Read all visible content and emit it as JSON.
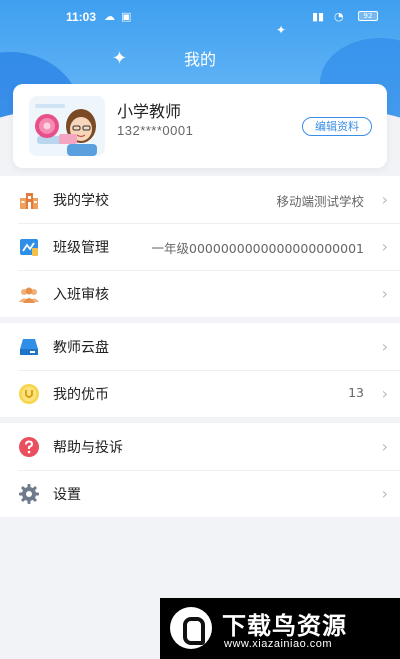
{
  "status_bar": {
    "time": "11:03",
    "battery": "92"
  },
  "header": {
    "title": "我的"
  },
  "profile": {
    "name": "小学教师",
    "phone": "132****0001",
    "edit_label": "编辑资料"
  },
  "groups": [
    {
      "items": [
        {
          "icon": "school-building-icon",
          "label": "我的学校",
          "value": "移动端测试学校"
        },
        {
          "icon": "class-management-icon",
          "label": "班级管理",
          "value": "一年级0000000000000000000001"
        },
        {
          "icon": "people-icon",
          "label": "入班审核",
          "value": ""
        }
      ]
    },
    {
      "items": [
        {
          "icon": "cloud-drive-icon",
          "label": "教师云盘",
          "value": ""
        },
        {
          "icon": "coin-icon",
          "label": "我的优币",
          "value": "13"
        }
      ]
    },
    {
      "items": [
        {
          "icon": "help-icon",
          "label": "帮助与投诉",
          "value": ""
        },
        {
          "icon": "gear-icon",
          "label": "设置",
          "value": ""
        }
      ]
    }
  ],
  "watermark": {
    "title": "下载鸟资源",
    "url": "www.xiazainiao.com"
  },
  "colors": {
    "header_blue": "#3f9ff0",
    "accent": "#3a8ee6",
    "background": "#f2f3f7"
  }
}
